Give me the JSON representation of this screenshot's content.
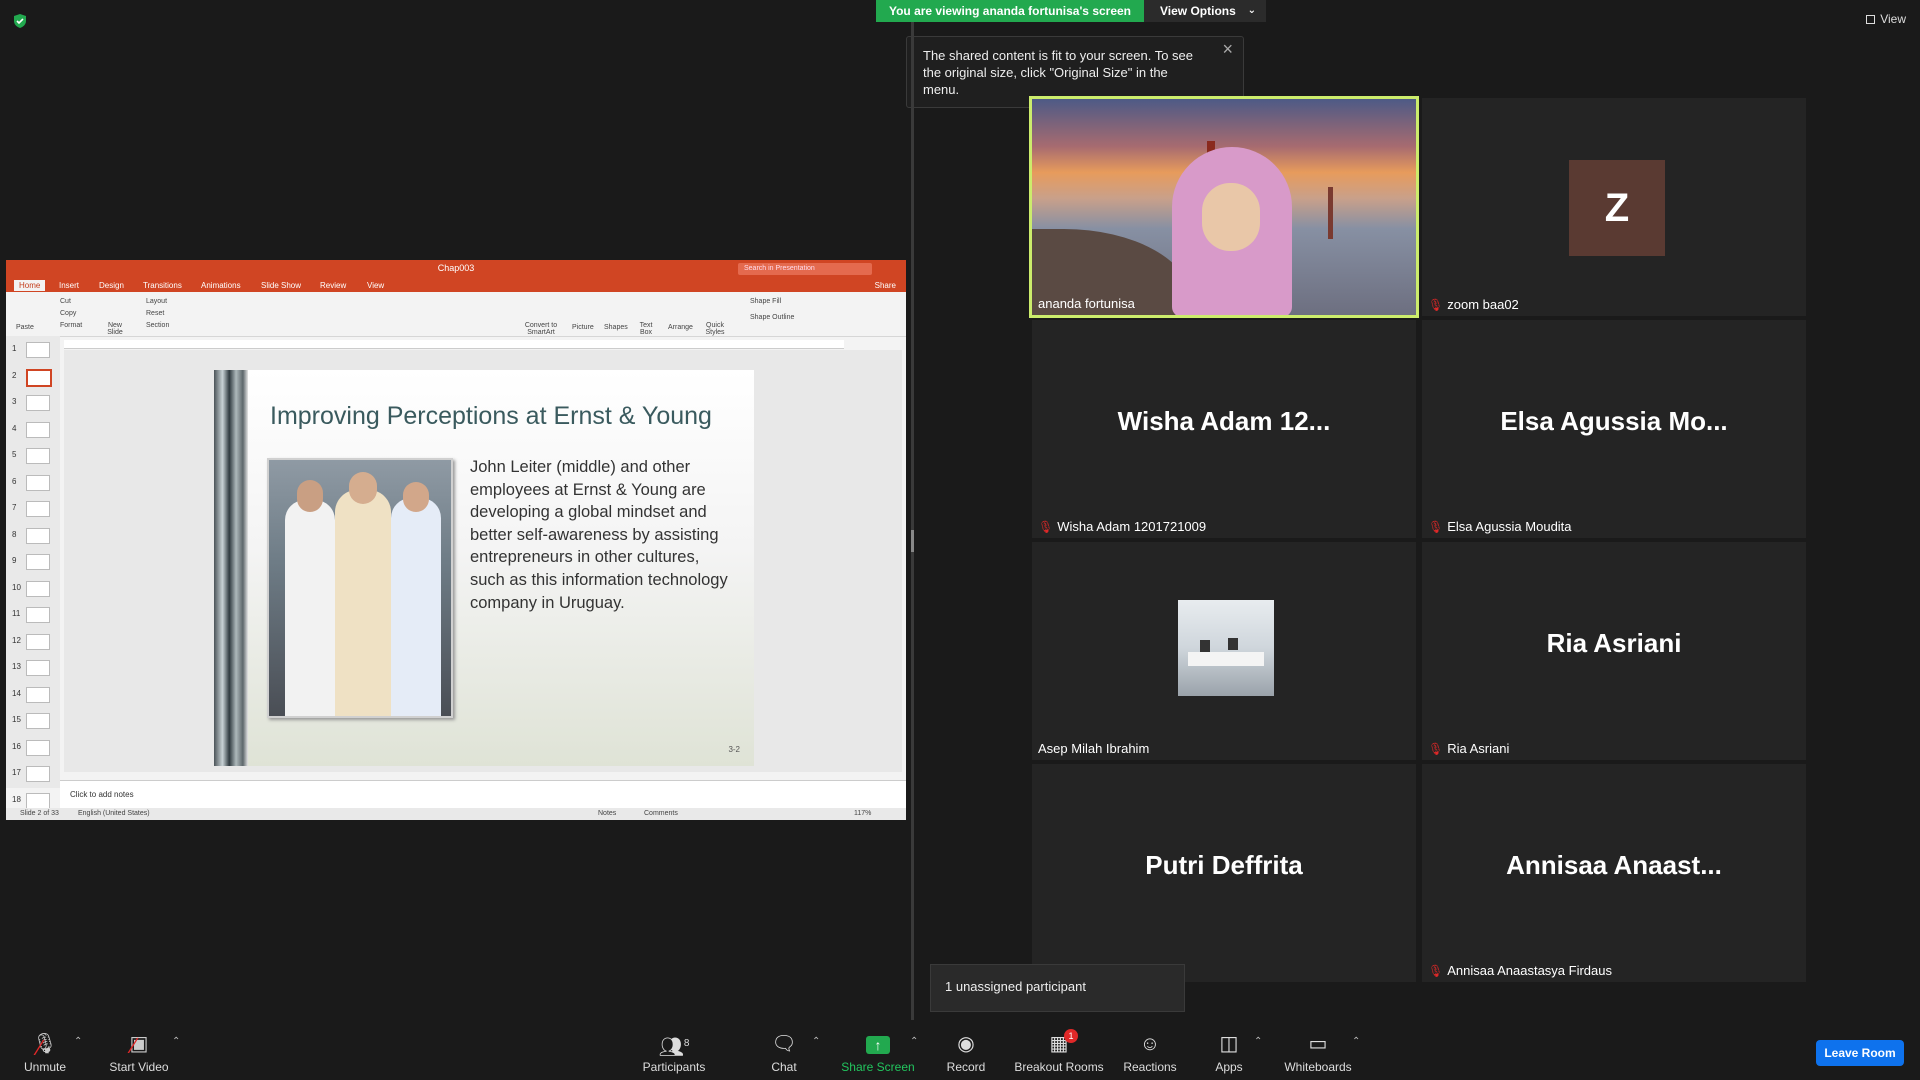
{
  "banner": {
    "viewing_text": "You are viewing ananda fortunisa's screen",
    "view_options_label": "View Options",
    "view_label": "View"
  },
  "tooltip": {
    "text": "The shared content is fit to your screen. To see the original size, click \"Original Size\" in the menu."
  },
  "ppt": {
    "file_title": "Chap003",
    "search_placeholder": "Search in Presentation",
    "tabs": [
      "Home",
      "Insert",
      "Design",
      "Transitions",
      "Animations",
      "Slide Show",
      "Review",
      "View"
    ],
    "share_label": "Share",
    "ribbon": {
      "paste": "Paste",
      "cut": "Cut",
      "copy": "Copy",
      "format": "Format",
      "new_slide": "New Slide",
      "layout": "Layout",
      "reset": "Reset",
      "section": "Section",
      "convert": "Convert to SmartArt",
      "picture": "Picture",
      "shapes": "Shapes",
      "text_box": "Text Box",
      "arrange": "Arrange",
      "quick_styles": "Quick Styles",
      "shape_fill": "Shape Fill",
      "shape_outline": "Shape Outline"
    },
    "thumb_numbers": [
      "1",
      "2",
      "3",
      "4",
      "5",
      "6",
      "7",
      "8",
      "9",
      "10",
      "11",
      "12",
      "13",
      "14",
      "15",
      "16",
      "17",
      "18"
    ],
    "slide": {
      "title": "Improving Perceptions at Ernst & Young",
      "body": "John Leiter (middle) and other employees at Ernst & Young are developing a global mindset and better self-awareness by assisting entrepreneurs in other cultures, such as this information technology company in Uruguay.",
      "number": "3-2"
    },
    "notes_placeholder": "Click to add notes",
    "status": {
      "slide_of": "Slide 2 of 33",
      "language": "English (United States)",
      "notes": "Notes",
      "comments": "Comments",
      "zoom": "117%"
    }
  },
  "participants": [
    {
      "display": "",
      "label": "ananda fortunisa",
      "muted": false
    },
    {
      "display": "Z",
      "label": "zoom baa02",
      "muted": true
    },
    {
      "display": "Wisha Adam 12...",
      "label": "Wisha Adam 1201721009",
      "muted": true
    },
    {
      "display": "Elsa Agussia Mo...",
      "label": "Elsa Agussia Moudita",
      "muted": true
    },
    {
      "display": "",
      "label": "Asep Milah Ibrahim",
      "muted": false
    },
    {
      "display": "Ria Asriani",
      "label": "Ria Asriani",
      "muted": true
    },
    {
      "display": "Putri Deffrita",
      "label": "",
      "muted": false
    },
    {
      "display": "Annisaa Anaast...",
      "label": "Annisaa Anaastasya Firdaus",
      "muted": true
    }
  ],
  "unassigned": "1 unassigned participant",
  "toolbar": {
    "unmute": "Unmute",
    "start_video": "Start Video",
    "participants": "Participants",
    "participants_count": "8",
    "chat": "Chat",
    "share_screen": "Share Screen",
    "record": "Record",
    "breakout_rooms": "Breakout Rooms",
    "breakout_badge": "1",
    "reactions": "Reactions",
    "apps": "Apps",
    "whiteboards": "Whiteboards",
    "leave_room": "Leave Room"
  },
  "colors": {
    "banner_green": "#22a94f",
    "active_speaker": "#ccec6c",
    "muted_red": "#e02828",
    "leave_blue": "#0e72ed",
    "ppt_orange": "#d04523"
  }
}
